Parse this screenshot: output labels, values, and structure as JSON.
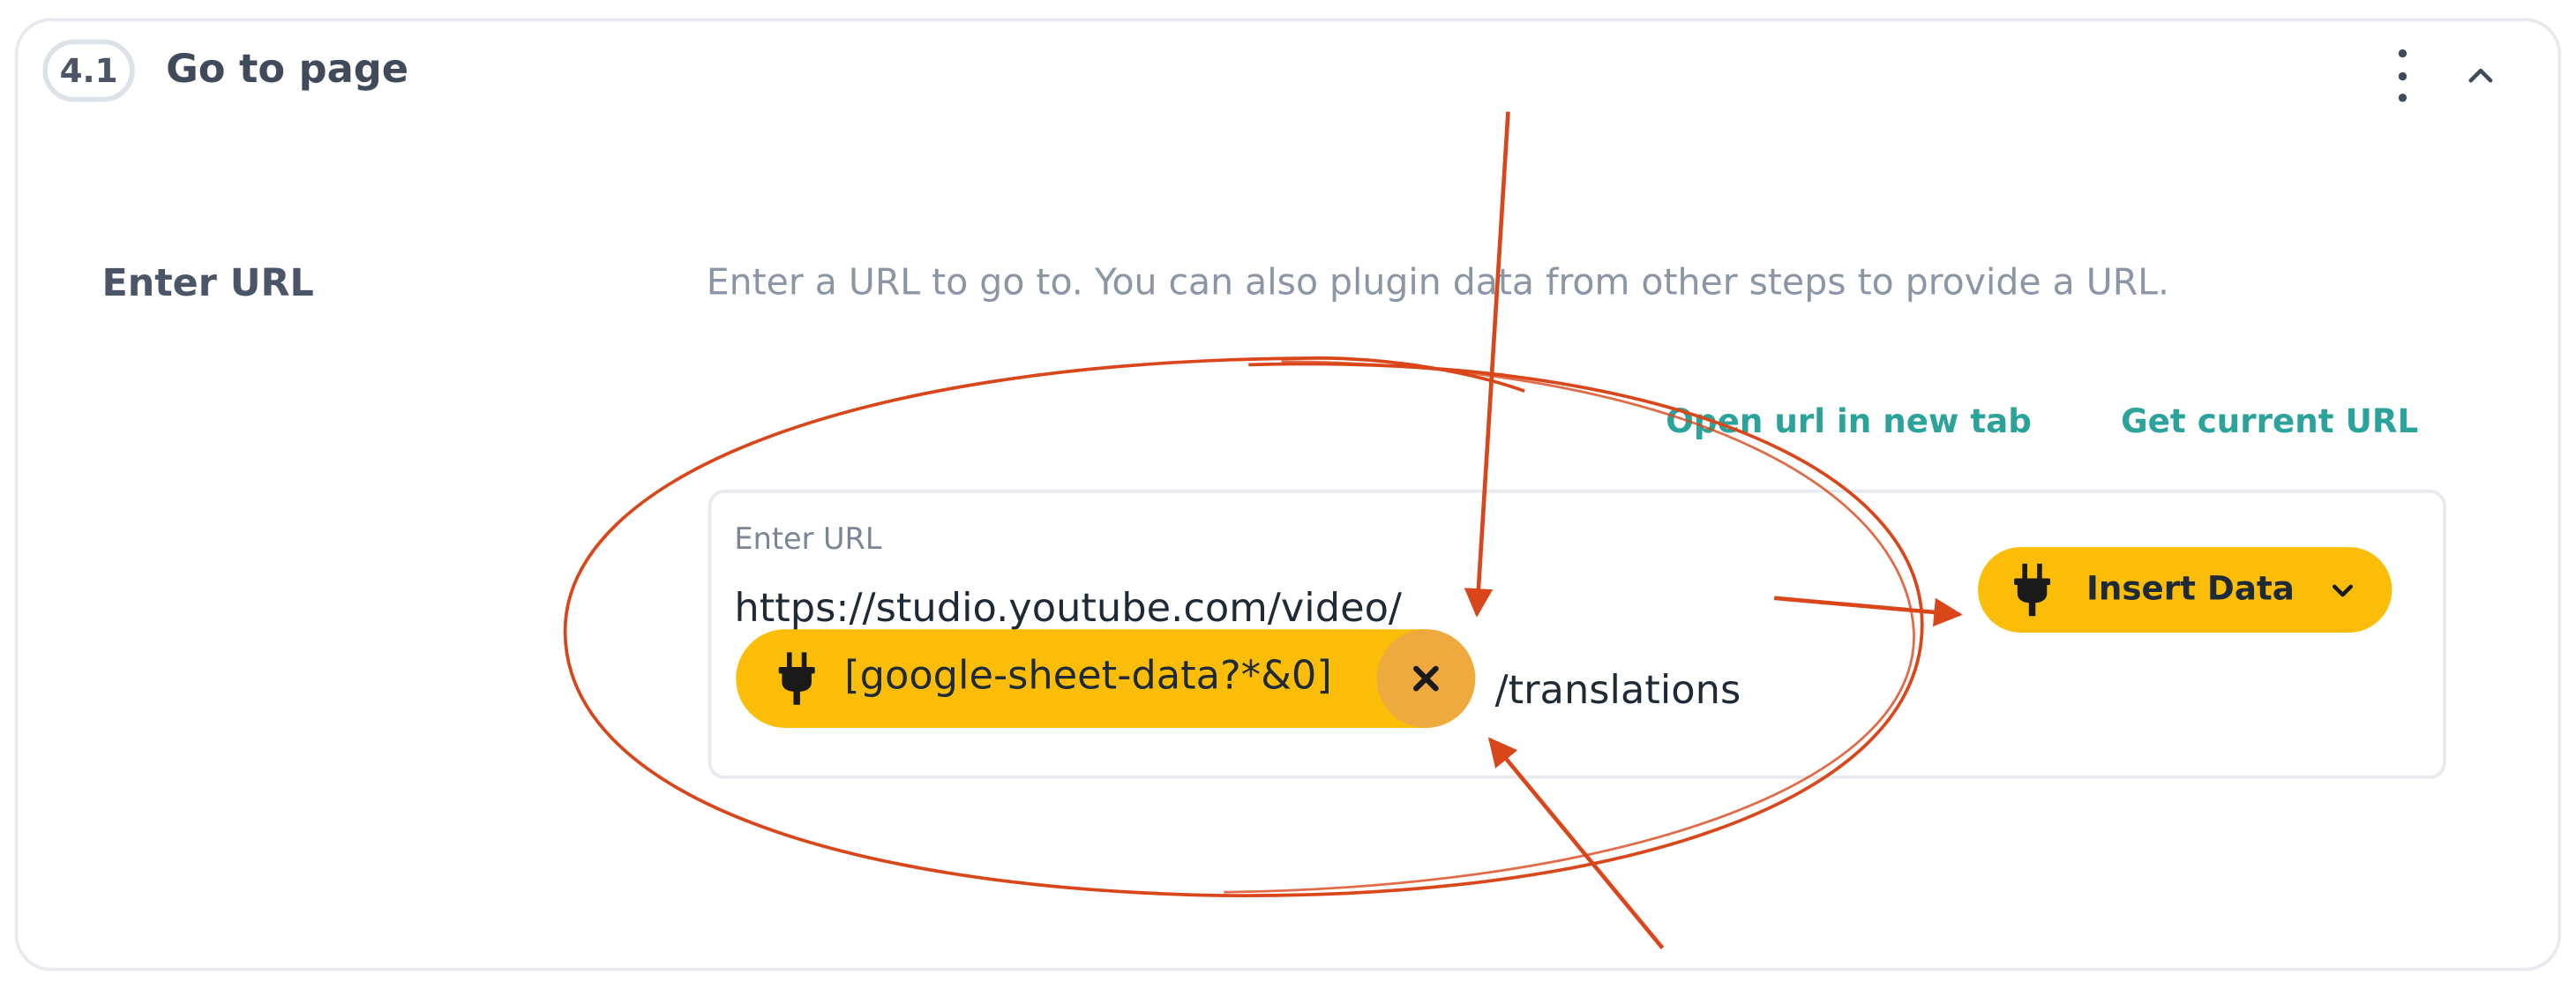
{
  "step": {
    "number": "4.1",
    "title": "Go to page"
  },
  "field": {
    "label": "Enter URL",
    "description": "Enter a URL to go to. You can also plugin data from other steps to provide a URL."
  },
  "links": {
    "open_new_tab": "Open url in new tab",
    "get_current_url": "Get current URL"
  },
  "url_input": {
    "label": "Enter URL",
    "prefix": "https://studio.youtube.com/video/",
    "chip_text": "[google-sheet-data?*&0]",
    "suffix": "/translations"
  },
  "insert_button": {
    "label": "Insert Data"
  },
  "icons": {
    "kebab": "more-vertical-icon",
    "collapse": "chevron-up-icon",
    "chip": "plug-icon",
    "chip_remove": "close-icon",
    "insert": "plug-icon",
    "insert_dropdown": "chevron-down-icon"
  },
  "colors": {
    "accent_link": "#2ba39a",
    "chip_bg": "#fbbd08",
    "chip_remove_bg": "#eeaa3e",
    "annotation": "#d9461a"
  }
}
